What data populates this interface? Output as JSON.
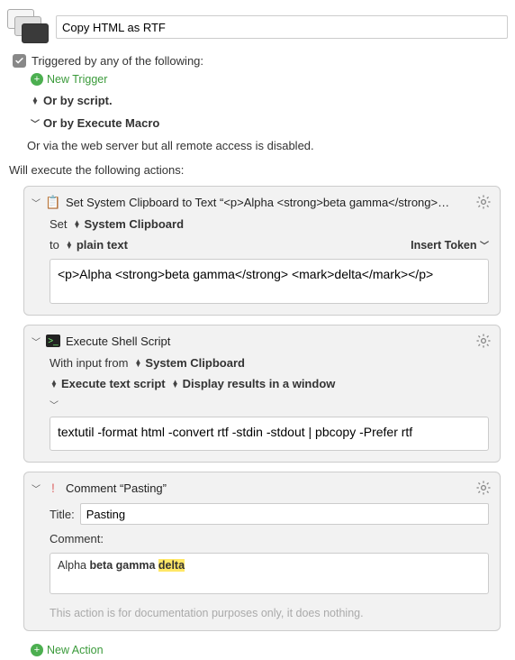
{
  "header": {
    "title": "Copy HTML as RTF"
  },
  "trigger": {
    "label": "Triggered by any of the following:",
    "checked": true,
    "new_trigger": "New Trigger",
    "or_script": "Or by script.",
    "or_execute_macro": "Or by Execute Macro",
    "or_via": "Or via the web server but all remote access is disabled."
  },
  "exec_heading": "Will execute the following actions:",
  "actions": [
    {
      "icon": "clipboard-icon",
      "title": "Set System Clipboard to Text “<p>Alpha <strong>beta gamma</strong>…",
      "set_label": "Set",
      "set_target": "System Clipboard",
      "to_label": "to",
      "to_mode": "plain text",
      "insert_token": "Insert Token",
      "text_value": "<p>Alpha <strong>beta gamma</strong> <mark>delta</mark></p>"
    },
    {
      "icon": "terminal-icon",
      "title": "Execute Shell Script",
      "with_input_label": "With input from",
      "with_input_source": "System Clipboard",
      "exec_mode": "Execute text script",
      "display_mode": "Display results in a window",
      "script_value": "textutil -format html -convert rtf -stdin -stdout | pbcopy -Prefer rtf"
    },
    {
      "icon": "comment-icon",
      "title": "Comment “Pasting”",
      "title_label": "Title:",
      "title_value": "Pasting",
      "comment_label": "Comment:",
      "comment_parts": {
        "t1": "Alpha ",
        "b1": "beta gamma ",
        "m1": "delta"
      },
      "doc_note": "This action is for documentation purposes only, it does nothing."
    }
  ],
  "new_action": "New Action"
}
